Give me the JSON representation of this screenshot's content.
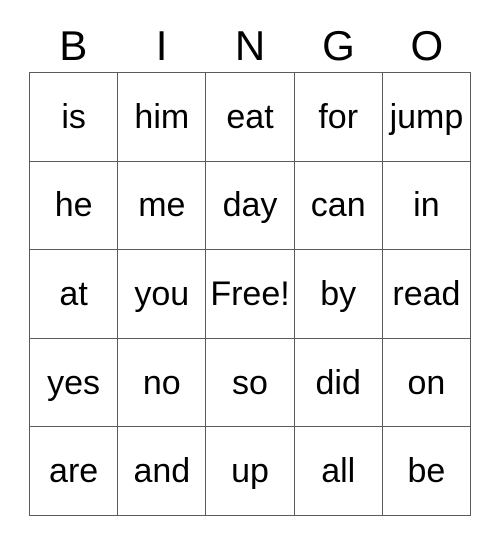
{
  "card": {
    "headers": [
      "B",
      "I",
      "N",
      "G",
      "O"
    ],
    "rows": [
      {
        "cells": [
          "is",
          "him",
          "eat",
          "for",
          "jump"
        ]
      },
      {
        "cells": [
          "he",
          "me",
          "day",
          "can",
          "in"
        ]
      },
      {
        "cells": [
          "at",
          "you",
          "Free!",
          "by",
          "read"
        ]
      },
      {
        "cells": [
          "yes",
          "no",
          "so",
          "did",
          "on"
        ]
      },
      {
        "cells": [
          "are",
          "and",
          "up",
          "all",
          "be"
        ]
      }
    ],
    "free_space_label": "Free!",
    "colors": {
      "text": "#000000",
      "grid_line": "#5b5b5b",
      "background": "#ffffff"
    }
  }
}
